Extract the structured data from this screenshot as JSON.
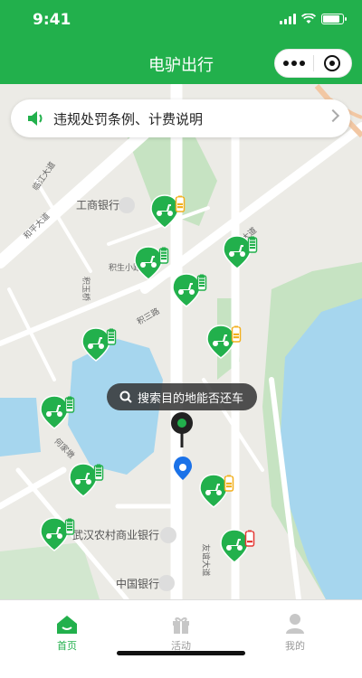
{
  "status_bar": {
    "time": "9:41"
  },
  "header": {
    "title": "电驴出行"
  },
  "notice": {
    "label": "违规处罚条例、计费说明"
  },
  "search_bubble": {
    "label": "搜索目的地能否还车"
  },
  "map_labels": {
    "icbc": "工商银行",
    "rural_bank": "武汉农村商业银行",
    "boc": "中国银行",
    "heping_ave": "和平大道",
    "youyi_ave": "友谊大道",
    "youyi_ave2": "友谊大道",
    "lingong_ave": "临江大道",
    "jiyu": "积玉桥",
    "jisheng": "积生小路",
    "jisan": "积三路",
    "hejiang": "何家墩"
  },
  "colors": {
    "brand": "#22b04c",
    "water": "#a6d6ee",
    "park": "#c6e3c2"
  },
  "scooters": [
    {
      "battery": "yellow"
    },
    {
      "battery": "green"
    },
    {
      "battery": "green"
    },
    {
      "battery": "green"
    },
    {
      "battery": "green"
    },
    {
      "battery": "yellow"
    },
    {
      "battery": "green"
    },
    {
      "battery": "green"
    },
    {
      "battery": "yellow"
    },
    {
      "battery": "green"
    },
    {
      "battery": "red"
    }
  ],
  "tabs": [
    {
      "label": "首页",
      "icon": "home-icon",
      "active": true
    },
    {
      "label": "活动",
      "icon": "gift-icon",
      "active": false
    },
    {
      "label": "我的",
      "icon": "user-icon",
      "active": false
    }
  ]
}
